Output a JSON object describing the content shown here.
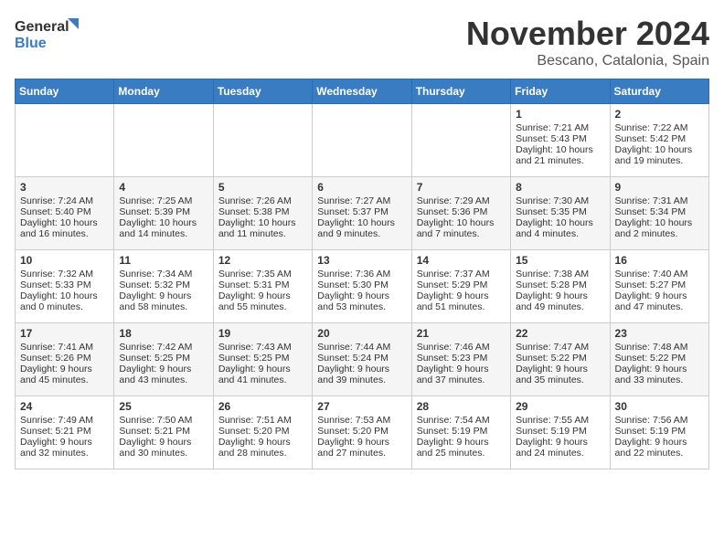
{
  "logo": {
    "line1": "General",
    "line2": "Blue"
  },
  "title": "November 2024",
  "location": "Bescano, Catalonia, Spain",
  "headers": [
    "Sunday",
    "Monday",
    "Tuesday",
    "Wednesday",
    "Thursday",
    "Friday",
    "Saturday"
  ],
  "weeks": [
    [
      {
        "day": "",
        "data": ""
      },
      {
        "day": "",
        "data": ""
      },
      {
        "day": "",
        "data": ""
      },
      {
        "day": "",
        "data": ""
      },
      {
        "day": "",
        "data": ""
      },
      {
        "day": "1",
        "data": "Sunrise: 7:21 AM\nSunset: 5:43 PM\nDaylight: 10 hours and 21 minutes."
      },
      {
        "day": "2",
        "data": "Sunrise: 7:22 AM\nSunset: 5:42 PM\nDaylight: 10 hours and 19 minutes."
      }
    ],
    [
      {
        "day": "3",
        "data": "Sunrise: 7:24 AM\nSunset: 5:40 PM\nDaylight: 10 hours and 16 minutes."
      },
      {
        "day": "4",
        "data": "Sunrise: 7:25 AM\nSunset: 5:39 PM\nDaylight: 10 hours and 14 minutes."
      },
      {
        "day": "5",
        "data": "Sunrise: 7:26 AM\nSunset: 5:38 PM\nDaylight: 10 hours and 11 minutes."
      },
      {
        "day": "6",
        "data": "Sunrise: 7:27 AM\nSunset: 5:37 PM\nDaylight: 10 hours and 9 minutes."
      },
      {
        "day": "7",
        "data": "Sunrise: 7:29 AM\nSunset: 5:36 PM\nDaylight: 10 hours and 7 minutes."
      },
      {
        "day": "8",
        "data": "Sunrise: 7:30 AM\nSunset: 5:35 PM\nDaylight: 10 hours and 4 minutes."
      },
      {
        "day": "9",
        "data": "Sunrise: 7:31 AM\nSunset: 5:34 PM\nDaylight: 10 hours and 2 minutes."
      }
    ],
    [
      {
        "day": "10",
        "data": "Sunrise: 7:32 AM\nSunset: 5:33 PM\nDaylight: 10 hours and 0 minutes."
      },
      {
        "day": "11",
        "data": "Sunrise: 7:34 AM\nSunset: 5:32 PM\nDaylight: 9 hours and 58 minutes."
      },
      {
        "day": "12",
        "data": "Sunrise: 7:35 AM\nSunset: 5:31 PM\nDaylight: 9 hours and 55 minutes."
      },
      {
        "day": "13",
        "data": "Sunrise: 7:36 AM\nSunset: 5:30 PM\nDaylight: 9 hours and 53 minutes."
      },
      {
        "day": "14",
        "data": "Sunrise: 7:37 AM\nSunset: 5:29 PM\nDaylight: 9 hours and 51 minutes."
      },
      {
        "day": "15",
        "data": "Sunrise: 7:38 AM\nSunset: 5:28 PM\nDaylight: 9 hours and 49 minutes."
      },
      {
        "day": "16",
        "data": "Sunrise: 7:40 AM\nSunset: 5:27 PM\nDaylight: 9 hours and 47 minutes."
      }
    ],
    [
      {
        "day": "17",
        "data": "Sunrise: 7:41 AM\nSunset: 5:26 PM\nDaylight: 9 hours and 45 minutes."
      },
      {
        "day": "18",
        "data": "Sunrise: 7:42 AM\nSunset: 5:25 PM\nDaylight: 9 hours and 43 minutes."
      },
      {
        "day": "19",
        "data": "Sunrise: 7:43 AM\nSunset: 5:25 PM\nDaylight: 9 hours and 41 minutes."
      },
      {
        "day": "20",
        "data": "Sunrise: 7:44 AM\nSunset: 5:24 PM\nDaylight: 9 hours and 39 minutes."
      },
      {
        "day": "21",
        "data": "Sunrise: 7:46 AM\nSunset: 5:23 PM\nDaylight: 9 hours and 37 minutes."
      },
      {
        "day": "22",
        "data": "Sunrise: 7:47 AM\nSunset: 5:22 PM\nDaylight: 9 hours and 35 minutes."
      },
      {
        "day": "23",
        "data": "Sunrise: 7:48 AM\nSunset: 5:22 PM\nDaylight: 9 hours and 33 minutes."
      }
    ],
    [
      {
        "day": "24",
        "data": "Sunrise: 7:49 AM\nSunset: 5:21 PM\nDaylight: 9 hours and 32 minutes."
      },
      {
        "day": "25",
        "data": "Sunrise: 7:50 AM\nSunset: 5:21 PM\nDaylight: 9 hours and 30 minutes."
      },
      {
        "day": "26",
        "data": "Sunrise: 7:51 AM\nSunset: 5:20 PM\nDaylight: 9 hours and 28 minutes."
      },
      {
        "day": "27",
        "data": "Sunrise: 7:53 AM\nSunset: 5:20 PM\nDaylight: 9 hours and 27 minutes."
      },
      {
        "day": "28",
        "data": "Sunrise: 7:54 AM\nSunset: 5:19 PM\nDaylight: 9 hours and 25 minutes."
      },
      {
        "day": "29",
        "data": "Sunrise: 7:55 AM\nSunset: 5:19 PM\nDaylight: 9 hours and 24 minutes."
      },
      {
        "day": "30",
        "data": "Sunrise: 7:56 AM\nSunset: 5:19 PM\nDaylight: 9 hours and 22 minutes."
      }
    ]
  ]
}
